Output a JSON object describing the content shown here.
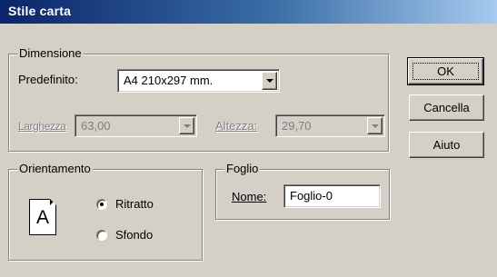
{
  "window": {
    "title": "Stile carta"
  },
  "dimensione": {
    "legend": "Dimensione",
    "predefinito_label": "Predefinito:",
    "predefinito_value": "A4 210x297 mm.",
    "larghezza_label": "Larghezza",
    "larghezza_value": "63,00",
    "altezza_label": "Altezza:",
    "altezza_value": "29,70"
  },
  "orientamento": {
    "legend": "Orientamento",
    "page_letter": "A",
    "options": [
      {
        "label": "Ritratto",
        "selected": true
      },
      {
        "label": "Sfondo",
        "selected": false
      }
    ]
  },
  "foglio": {
    "legend": "Foglio",
    "nome_label": "Nome:",
    "nome_value": "Foglio-0"
  },
  "buttons": {
    "ok": "OK",
    "cancel": "Cancella",
    "help": "Aiuto"
  },
  "colors": {
    "title_gradient_start": "#0a246a",
    "title_gradient_end": "#a6caf0",
    "face": "#d4d0c8"
  }
}
